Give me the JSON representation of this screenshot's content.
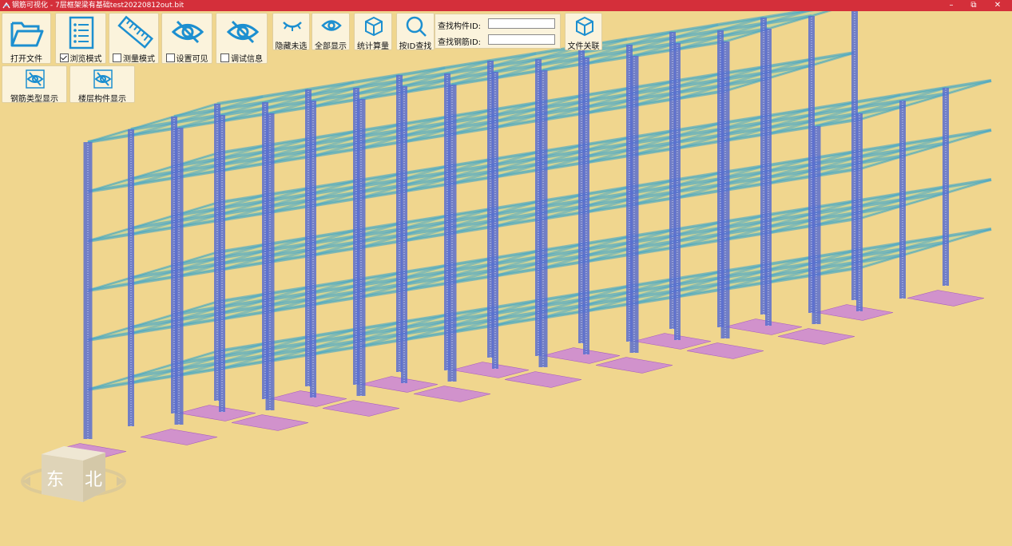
{
  "window": {
    "title": "钢筋可视化 - 7层框架梁有基础test20220812out.bit",
    "minimize": "–",
    "restore": "⧉",
    "close": "✕"
  },
  "toolbar": {
    "open_file": "打开文件",
    "browse_mode": "浏览模式",
    "browse_mode_checked": true,
    "measure_mode": "测量模式",
    "set_visible": "设置可见",
    "debug_info": "调试信息",
    "hide_unselected": "隐藏未选",
    "show_all": "全部显示",
    "statistics": "统计算量",
    "find_by_id": "按ID查找",
    "find_component_label": "查找构件ID:",
    "find_component_value": "",
    "find_rebar_label": "查找钢筋ID:",
    "find_rebar_value": "",
    "file_link": "文件关联",
    "rebar_type_display": "钢筋类型显示",
    "floor_component_display": "楼层构件显示"
  },
  "nav_cube": {
    "face_left": "东",
    "face_right": "北"
  },
  "colors": {
    "titlebar": "#d42f3a",
    "background": "#f0d68e",
    "icon_blue": "#1c8fd0",
    "column_blue": "#5b6fcf",
    "slab_green": "#6fd0b0",
    "footing_magenta": "#c77be0"
  }
}
